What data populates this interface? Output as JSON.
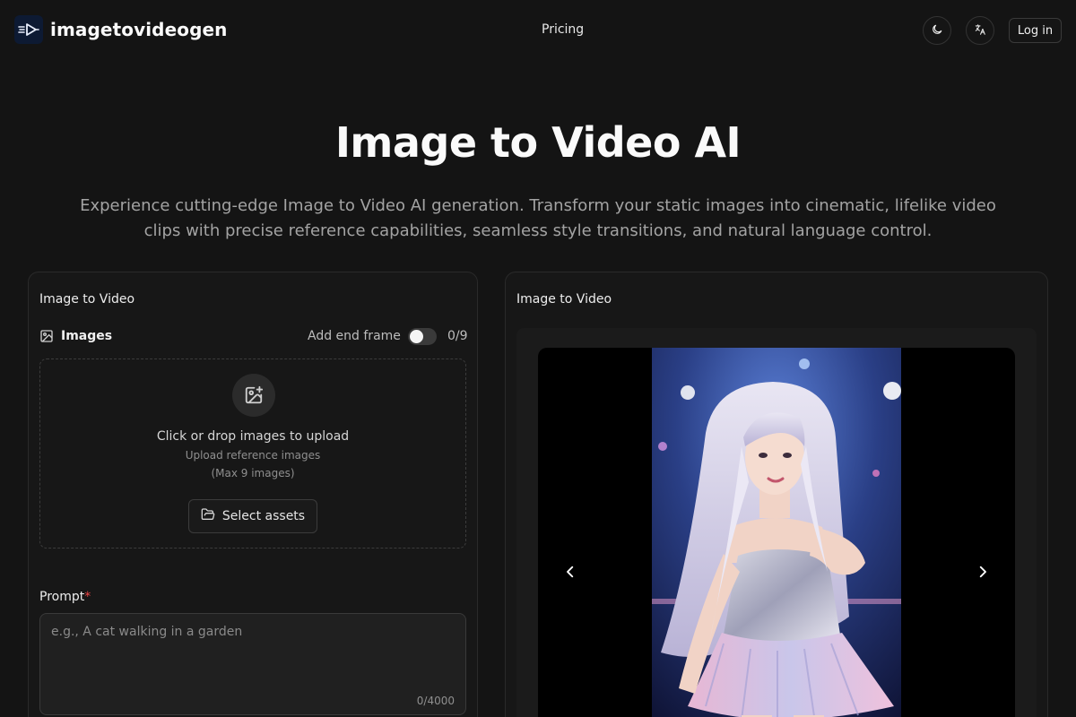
{
  "header": {
    "brand": "imagetovideogen",
    "nav_pricing": "Pricing",
    "login": "Log in"
  },
  "hero": {
    "title": "Image to Video AI",
    "subtitle": "Experience cutting-edge Image to Video AI generation. Transform your static images into cinematic, lifelike video clips with precise reference capabilities, seamless style transitions, and natural language control."
  },
  "form": {
    "card_title": "Image to Video",
    "images_label": "Images",
    "end_frame_label": "Add end frame",
    "end_frame_enabled": false,
    "image_count": "0/9",
    "drop_main": "Click or drop images to upload",
    "drop_sub": "Upload reference images",
    "drop_limit": "(Max 9 images)",
    "select_assets": "Select assets",
    "prompt_label": "Prompt",
    "prompt_required": "*",
    "prompt_placeholder": "e.g., A cat walking in a garden",
    "prompt_value": "",
    "prompt_count": "0/4000"
  },
  "preview": {
    "card_title": "Image to Video"
  },
  "colors": {
    "background": "#141414",
    "card": "#171717",
    "border": "#2a2a2a",
    "required": "#ef4444",
    "logo_bg": "#0d1a33"
  },
  "icons": {
    "logo": "play-wing-icon",
    "theme": "moon-icon",
    "language": "translate-icon",
    "images": "image-icon",
    "upload": "image-plus-icon",
    "folder": "folder-open-icon",
    "prev": "chevron-left-icon",
    "next": "chevron-right-icon"
  }
}
